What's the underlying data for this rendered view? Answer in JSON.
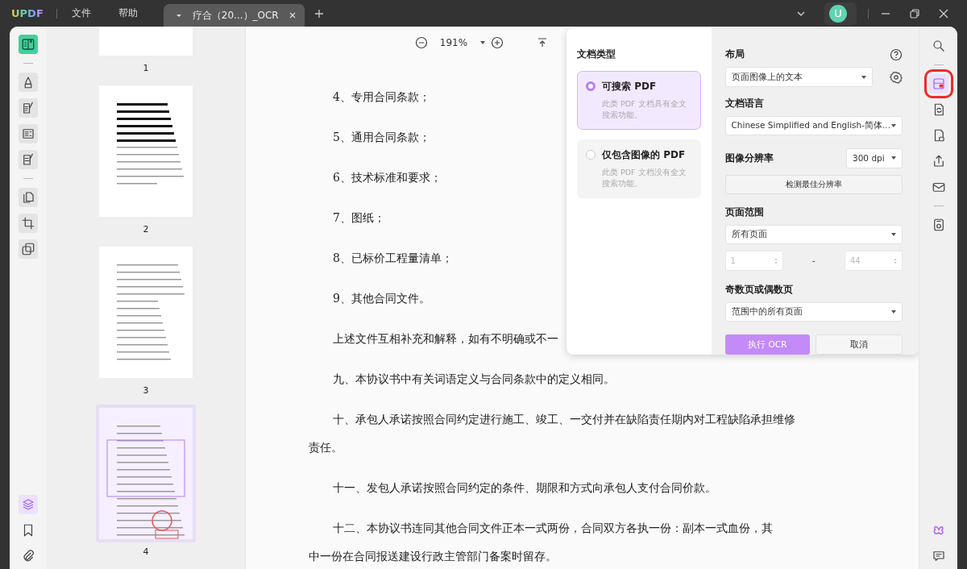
{
  "titlebar": {
    "logo": "UPDF",
    "menu": [
      "文件",
      "帮助"
    ],
    "avatar": "U"
  },
  "tabs": [
    {
      "label": "疗合（20...）_OCR",
      "selected": true
    }
  ],
  "left_tools": [
    {
      "kind": "reader",
      "selected": true
    },
    {
      "kind": "highlighter",
      "selected": false
    },
    {
      "kind": "edit",
      "selected": false
    },
    {
      "kind": "form",
      "selected": false
    },
    {
      "kind": "sign",
      "selected": false
    },
    {
      "kind": "pages",
      "selected": false
    },
    {
      "kind": "crop",
      "selected": false
    },
    {
      "kind": "stamp",
      "selected": false
    },
    {
      "kind": "layers",
      "selected": true
    },
    {
      "kind": "bookmark",
      "selected": false
    },
    {
      "kind": "attachment",
      "selected": false
    }
  ],
  "thumbnails": [
    {
      "label": "1",
      "selected": false
    },
    {
      "label": "2",
      "selected": false
    },
    {
      "label": "3",
      "selected": false
    },
    {
      "label": "4",
      "selected": true
    }
  ],
  "zoom": {
    "value": "191%"
  },
  "document": {
    "lines": [
      {
        "kind": "item",
        "text": "4、专用合同条款；"
      },
      {
        "kind": "item",
        "text": "5、通用合同条款；"
      },
      {
        "kind": "item",
        "text": "6、技术标准和要求；"
      },
      {
        "kind": "item",
        "text": "7、图纸；"
      },
      {
        "kind": "item",
        "text": "8、已标价工程量清单；"
      },
      {
        "kind": "item",
        "text": "9、其他合同文件。"
      },
      {
        "kind": "item",
        "text": "上述文件互相补充和解释，如有不明确或不一"
      },
      {
        "kind": "item",
        "text": "九、本协议书中有关词语定义与合同条款中的定义相同。"
      },
      {
        "kind": "item",
        "text": "十、承包人承诺按照合同约定进行施工、竣工、一交付并在缺陷责任期内对工程缺陷承担维修"
      },
      {
        "kind": "continuation",
        "text": "责任。"
      },
      {
        "kind": "item",
        "text": "十一、发包人承诺按照合同约定的条件、期限和方式向承包人支付合同价款。"
      },
      {
        "kind": "item",
        "text": "十二、本协议书连同其他合同文件正本一式两份，合同双方各执一份：副本一式血份，其"
      },
      {
        "kind": "continuation",
        "text": "中一份在合同报送建设行政主管部门备案时留存。"
      }
    ]
  },
  "ocr_panel": {
    "doc_type_title": "文档类型",
    "options": [
      {
        "title": "可搜索 PDF",
        "description": "此类 PDF 文档具有全文搜索功能。",
        "selected": true
      },
      {
        "title": "仅包含图像的 PDF",
        "description": "此类 PDF 文档没有全文搜索功能。",
        "selected": false
      }
    ],
    "layout": {
      "label": "布局",
      "value": "页面图像上的文本"
    },
    "language": {
      "label": "文档语言",
      "value": "Chinese Simplified and English-简体..."
    },
    "resolution": {
      "label": "图像分辨率",
      "value": "300 dpi",
      "detect_button": "检测最佳分辨率"
    },
    "page_range": {
      "label": "页面范围",
      "value": "所有页面",
      "from": "1",
      "separator": "-",
      "to": "44",
      "disabled": true
    },
    "odd_even": {
      "label": "奇数页或偶数页",
      "value": "范围中的所有页面"
    },
    "run_button": "执行 OCR",
    "cancel_button": "取消"
  },
  "right_tools": [
    {
      "kind": "search",
      "selected": false
    },
    {
      "kind": "ocr",
      "selected": true
    },
    {
      "kind": "convert",
      "selected": false
    },
    {
      "kind": "protect",
      "selected": false
    },
    {
      "kind": "share",
      "selected": false
    },
    {
      "kind": "mail",
      "selected": false
    },
    {
      "kind": "save",
      "selected": false
    },
    {
      "kind": "ai",
      "selected": false
    },
    {
      "kind": "comment",
      "selected": false
    }
  ]
}
